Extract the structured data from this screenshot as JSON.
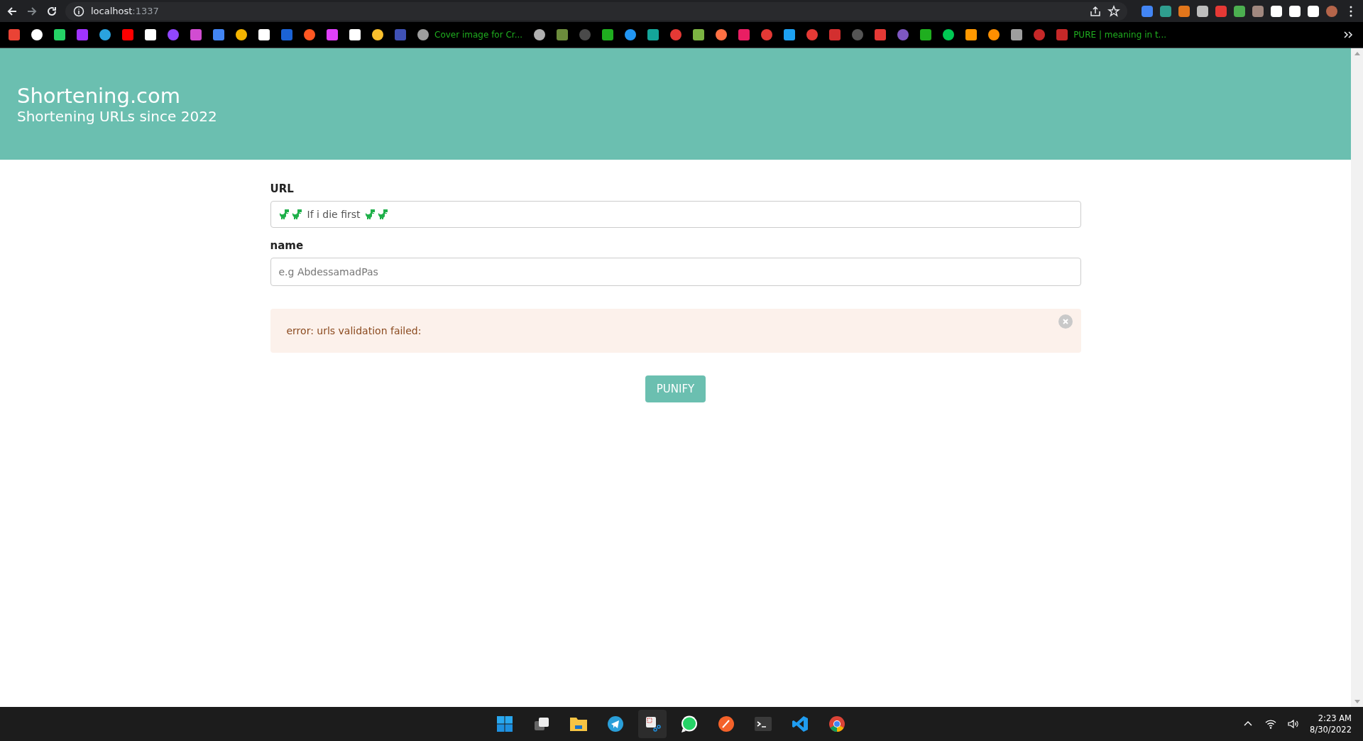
{
  "browser": {
    "address": {
      "host": "localhost",
      "port": ":1337"
    },
    "bookmarks": [
      {
        "label": "Cover image for Cr..."
      },
      {
        "label": "PURE | meaning in t..."
      }
    ]
  },
  "header": {
    "title": "Shortening.com",
    "subtitle": "Shortening URLs since 2022"
  },
  "form": {
    "fields": [
      {
        "label": "URL",
        "value": "If i die first"
      },
      {
        "label": "name",
        "placeholder": "e.g AbdessamadPas"
      }
    ],
    "alert": {
      "message": "error: urls validation failed:"
    },
    "submit": "PUNIFY"
  },
  "taskbar": {
    "time": "2:23 AM",
    "date": "8/30/2022"
  }
}
